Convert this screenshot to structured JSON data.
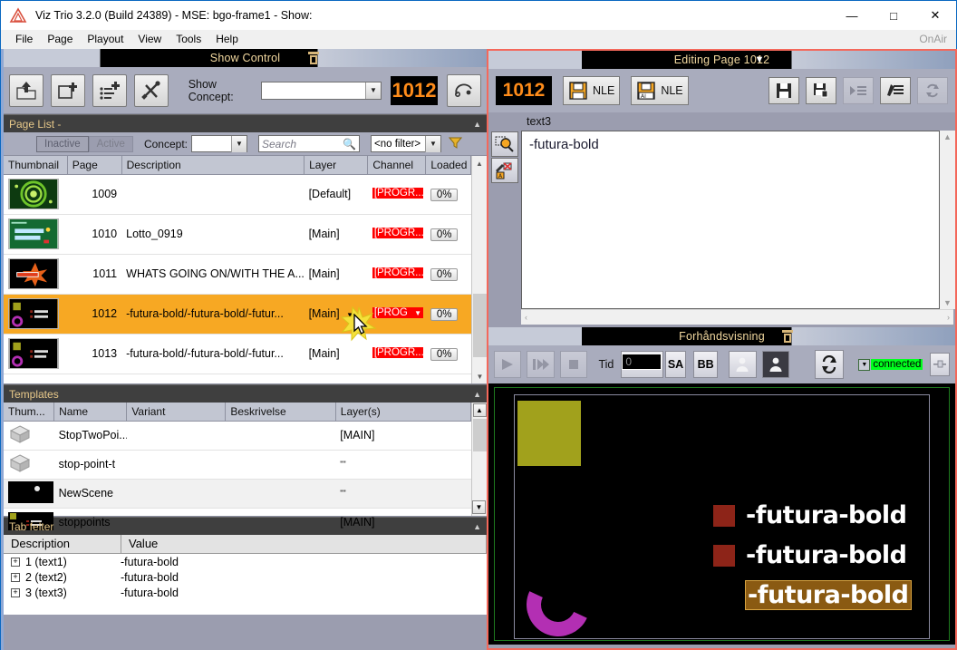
{
  "window": {
    "title": "Viz Trio 3.2.0 (Build 24389) - MSE: bgo-frame1 - Show:",
    "minimize_label": "—",
    "maximize_label": "□",
    "close_label": "✕",
    "app_icon": "viz-triangle-icon"
  },
  "menu": {
    "items": [
      "File",
      "Page",
      "Playout",
      "View",
      "Tools",
      "Help"
    ],
    "onair_label": "OnAir"
  },
  "show_control": {
    "panel_title": "Show Control",
    "toolbar": {
      "open_show": "open-show-icon",
      "new_page": "new-page-icon",
      "new_pagelist": "new-pagelist-icon",
      "config": "tools-icon",
      "concept_label": "Show Concept:",
      "concept_value": "",
      "page_number": "1012",
      "transition_icon": "transition-logic-icon"
    }
  },
  "page_list": {
    "section_title": "Page List -",
    "collapse_chevron": "▲",
    "filters": {
      "inactive_label": "Inactive",
      "active_label": "Active",
      "concept_label": "Concept:",
      "concept_value": "",
      "search_placeholder": "Search",
      "search_value": "",
      "filter_value": "<no filter>",
      "funnel_icon": "funnel-icon"
    },
    "columns": [
      "Thumbnail",
      "Page",
      "Description",
      "Layer",
      "Channel",
      "Loaded"
    ],
    "rows": [
      {
        "page": "1009",
        "description": "",
        "layer": "[Default]",
        "channel": "[PROGR...",
        "loaded": "0%",
        "selected": false,
        "thumb": "green-spiral-thumb"
      },
      {
        "page": "1010",
        "description": "Lotto_0919",
        "layer": "[Main]",
        "channel": "[PROGR...",
        "loaded": "0%",
        "selected": false,
        "thumb": "lotto-thumb"
      },
      {
        "page": "1011",
        "description": "WHATS GOING ON/WITH THE A...",
        "layer": "[Main]",
        "channel": "[PROGR...",
        "loaded": "0%",
        "selected": false,
        "thumb": "orange-burst-thumb"
      },
      {
        "page": "1012",
        "description": "-futura-bold/-futura-bold/-futur...",
        "layer": "[Main]",
        "channel": "[PROG",
        "loaded": "0%",
        "selected": true,
        "thumb": "futura-page-thumb"
      },
      {
        "page": "1013",
        "description": "-futura-bold/-futura-bold/-futur...",
        "layer": "[Main]",
        "channel": "[PROGR...",
        "loaded": "0%",
        "selected": false,
        "thumb": "futura-page-thumb-2"
      }
    ]
  },
  "templates": {
    "section_title": "Templates",
    "collapse_chevron": "▲",
    "columns": [
      "Thum...",
      "Name",
      "Variant",
      "Beskrivelse",
      "Layer(s)"
    ],
    "rows": [
      {
        "name": "StopTwoPoi...",
        "variant": "",
        "beskrivelse": "",
        "layers": "[MAIN]",
        "thumb": "cube-icon"
      },
      {
        "name": "stop-point-t",
        "variant": "",
        "beskrivelse": "",
        "layers": "\"\"",
        "thumb": "cube-icon"
      },
      {
        "name": "NewScene",
        "variant": "",
        "beskrivelse": "",
        "layers": "\"\"",
        "thumb": "black-scene-thumb"
      },
      {
        "name": "stoppoints",
        "variant": "",
        "beskrivelse": "",
        "layers": "[MAIN]",
        "thumb": "stoppoints-thumb"
      }
    ]
  },
  "tab_fields": {
    "section_title": "Tab felter",
    "collapse_chevron": "▲",
    "columns": [
      "Description",
      "Value"
    ],
    "rows": [
      {
        "expander": "+",
        "description": "1 (text1)",
        "value": "-futura-bold"
      },
      {
        "expander": "+",
        "description": "2 (text2)",
        "value": "-futura-bold"
      },
      {
        "expander": "+",
        "description": "3 (text3)",
        "value": "-futura-bold"
      }
    ]
  },
  "editor": {
    "panel_title": "Editing Page 1012",
    "panel_dropdown_icon": "chevron-down-icon",
    "page_number": "1012",
    "nle_save_label": "NLE",
    "nle_auto_label": "NLE",
    "buttons": {
      "save": "save-icon",
      "save_as": "save-as-icon",
      "read_page": "read-page-icon",
      "edit_page": "edit-page-icon",
      "refresh": "refresh-icon"
    },
    "side_buttons": {
      "zoom_field": "zoom-field-icon",
      "clear_field": "clear-field-icon"
    },
    "field_name": "text3",
    "field_value": "-futura-bold",
    "hscroll_left": "‹",
    "hscroll_right": "›"
  },
  "preview": {
    "panel_title": "Forhåndsvisning",
    "panel_icon": "detach-icon",
    "controls": {
      "play": "play-icon",
      "continue": "continue-icon",
      "stop": "stop-icon",
      "time_label": "Tid",
      "time_value": "0",
      "sa_label": "SA",
      "bb_label": "BB",
      "person_light": "person-light-icon",
      "person_dark": "person-dark-icon",
      "refresh": "refresh-icon",
      "connected_label": "connected",
      "connected_color": "#00ff1e",
      "snapshot": "snapshot-icon"
    },
    "stage": {
      "lines": [
        {
          "text": "-futura-bold",
          "highlighted": false
        },
        {
          "text": "-futura-bold",
          "highlighted": false
        },
        {
          "text": "-futura-bold",
          "highlighted": true
        }
      ],
      "colors": {
        "background": "#000000",
        "yellow_box": "#a1a11c",
        "purple_arc": "#b32fb3",
        "bullet": "#8d2418",
        "highlight": "#8a5a12",
        "safe_area_green": "#1f7a1f",
        "safe_area_white": "#8b8ba0"
      }
    }
  },
  "theme": {
    "accent_orange": "#ff8c1a",
    "selection_orange": "#f7a823",
    "panel_gray": "#a9acbd",
    "header_black": "#000000",
    "header_text": "#f3d9a0",
    "red_border": "#f4685b",
    "channel_red": "#ff0000"
  }
}
